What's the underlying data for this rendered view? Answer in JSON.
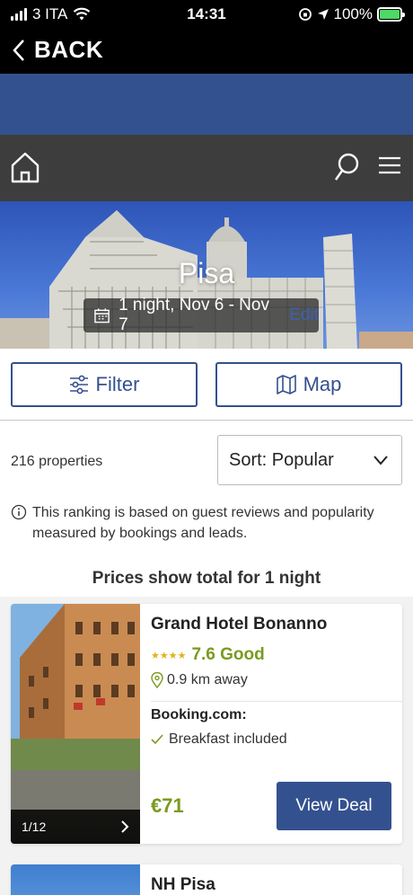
{
  "status_bar": {
    "carrier": "3 ITA",
    "time": "14:31",
    "battery": "100%"
  },
  "header": {
    "back_label": "BACK"
  },
  "hero": {
    "city": "Pisa",
    "dates": "1 night, Nov 6 - Nov 7",
    "edit_label": "Edit"
  },
  "toolbar": {
    "filter_label": "Filter",
    "map_label": "Map"
  },
  "results": {
    "count": "216 properties",
    "sort_label": "Sort: Popular",
    "ranking_note": "This ranking is based on guest reviews and popularity measured by bookings and leads.",
    "prices_note": "Prices show total for 1 night"
  },
  "hotels": [
    {
      "name": "Grand Hotel Bonanno",
      "stars": "★★★★",
      "rating": "7.6 Good",
      "distance": "0.9 km away",
      "provider": "Booking.com:",
      "perk": "Breakfast included",
      "price": "€71",
      "deal_label": "View Deal",
      "photo_index": "1/12"
    },
    {
      "name": "NH Pisa"
    }
  ],
  "colors": {
    "brand": "#34518f",
    "rating_green": "#7a9a1f",
    "star_gold": "#e0b21c"
  }
}
